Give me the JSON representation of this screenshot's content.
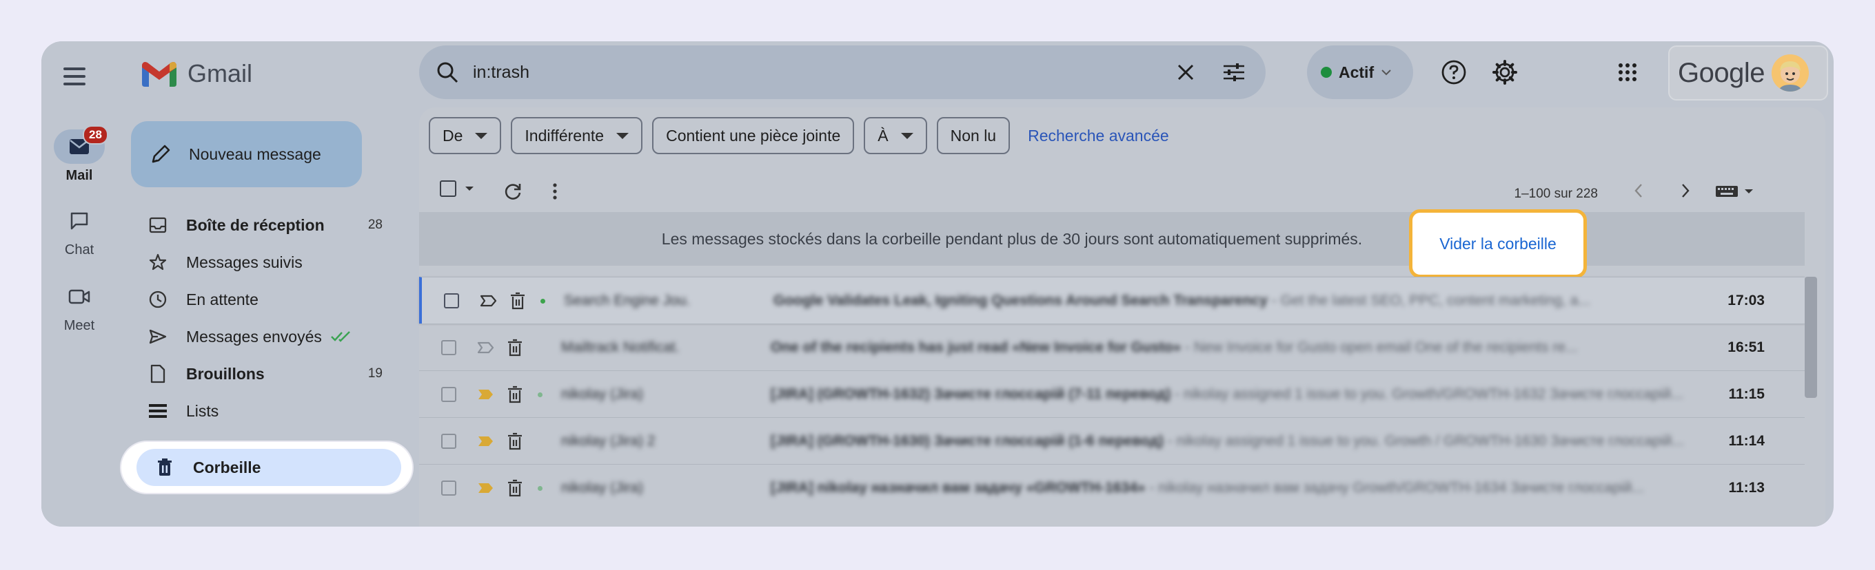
{
  "rail": {
    "items": [
      {
        "label": "Mail",
        "badge": "28"
      },
      {
        "label": "Chat"
      },
      {
        "label": "Meet"
      }
    ]
  },
  "app": {
    "name": "Gmail"
  },
  "compose": {
    "label": "Nouveau message"
  },
  "nav": {
    "items": [
      {
        "label": "Boîte de réception",
        "count": "28"
      },
      {
        "label": "Messages suivis",
        "count": ""
      },
      {
        "label": "En attente",
        "count": ""
      },
      {
        "label": "Messages envoyés",
        "count": ""
      },
      {
        "label": "Brouillons",
        "count": "19"
      },
      {
        "label": "Lists",
        "count": ""
      }
    ],
    "trash": {
      "label": "Corbeille"
    }
  },
  "search": {
    "query": "in:trash"
  },
  "status": {
    "label": "Actif",
    "color": "#1e8e3e"
  },
  "account": {
    "brand": "Google"
  },
  "filters": {
    "chips": [
      "De",
      "Indifférente",
      "Contient une pièce jointe",
      "À",
      "Non lu"
    ],
    "advanced": "Recherche avancée"
  },
  "toolbar": {
    "pager": "1–100 sur 228"
  },
  "banner": {
    "text": "Les messages stockés dans la corbeille pendant plus de 30 jours sont automatiquement supprimés.",
    "action": "Vider la corbeille",
    "highlight_color": "#f4b43a"
  },
  "emails": [
    {
      "sender": "Search Engine Jou.",
      "subject": "Google Validates Leak, Igniting Questions Around Search Transparency",
      "snippet": "- Get the latest SEO, PPC, content marketing, a...",
      "time": "17:03"
    },
    {
      "sender": "Mailtrack Notificat.",
      "subject": "One of the recipients has just read «New Invoice for Gusto»",
      "snippet": "- New Invoice for Gusto open email One of the recipients re...",
      "time": "16:51"
    },
    {
      "sender": "nikolay (Jira)",
      "subject": "[JIRA] (GROWTH-1632) Зачисте глоссарій (7-11 перевод)",
      "snippet": "- nikolay assigned 1 issue to you. Growth/GROWTH-1632 Зачисте глоссарій...",
      "time": "11:15"
    },
    {
      "sender": "nikolay (Jira) 2",
      "subject": "[JIRA] (GROWTH-1630) Зачисте глоссарій (1-6 перевод)",
      "snippet": "- nikolay assigned 1 issue to you. Growth / GROWTH-1630 Зачисте глоссарій...",
      "time": "11:14"
    },
    {
      "sender": "nikolay (Jira)",
      "subject": "[JIRA] nikolay назначил вам задачу «GROWTH-1634»",
      "snippet": "- nikolay назначил вам задачу Growth/GROWTH-1634 Зачисте глоссарій...",
      "time": "11:13"
    }
  ]
}
